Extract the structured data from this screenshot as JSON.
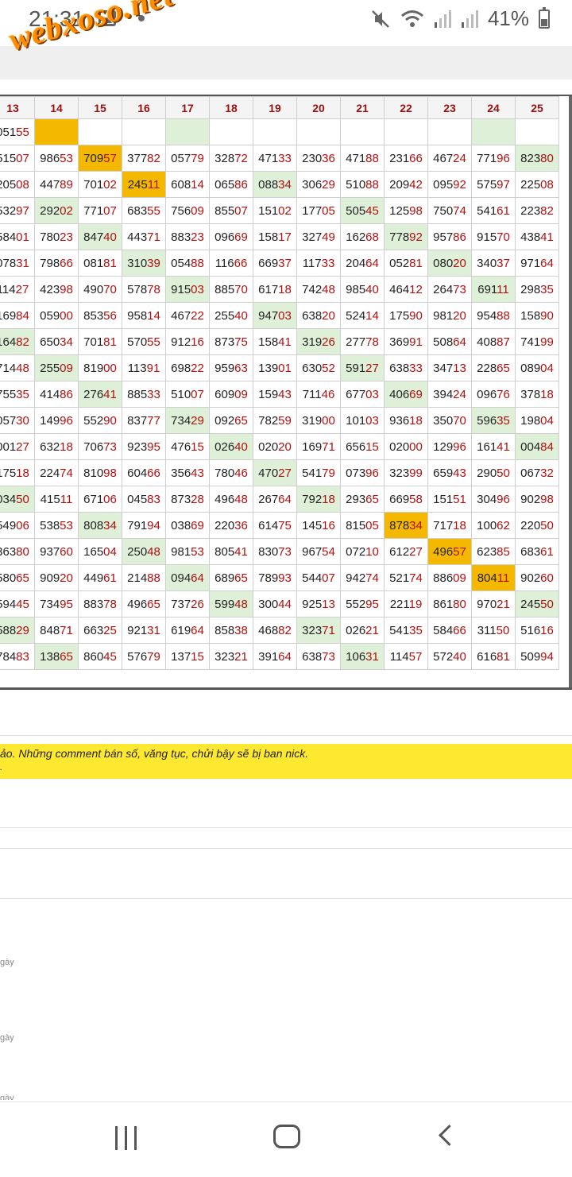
{
  "status_bar": {
    "time": "21:31",
    "battery_percent": "41%",
    "icons": [
      "image-icon",
      "app-notification-icon",
      "dot-icon",
      "mute-icon",
      "wifi-icon",
      "signal-icon",
      "signal-icon",
      "battery-icon"
    ]
  },
  "watermark": "webxoso.net",
  "table": {
    "columns": [
      "13",
      "14",
      "15",
      "16",
      "17",
      "18",
      "19",
      "20",
      "21",
      "22",
      "23",
      "24",
      "25"
    ],
    "rows": [
      [
        "05155",
        "",
        "",
        "",
        "",
        "",
        "",
        "",
        "",
        "",
        "",
        "",
        ""
      ],
      [
        "51507",
        "98653",
        "70957",
        "37782",
        "05779",
        "32872",
        "47133",
        "23036",
        "47188",
        "23166",
        "46724",
        "77196",
        "82380"
      ],
      [
        "20508",
        "44789",
        "70102",
        "24511",
        "60814",
        "06586",
        "08834",
        "30629",
        "51088",
        "20942",
        "09592",
        "57597",
        "22508"
      ],
      [
        "53297",
        "29202",
        "77107",
        "68355",
        "75609",
        "85507",
        "15102",
        "17705",
        "50545",
        "12598",
        "75074",
        "54161",
        "22382"
      ],
      [
        "58401",
        "78023",
        "84740",
        "44371",
        "88323",
        "09669",
        "15817",
        "32749",
        "16268",
        "77892",
        "95786",
        "91570",
        "43841"
      ],
      [
        "07831",
        "79866",
        "08181",
        "31039",
        "05488",
        "11666",
        "66937",
        "11733",
        "20464",
        "05281",
        "08020",
        "34037",
        "97164"
      ],
      [
        "11427",
        "42398",
        "49070",
        "57878",
        "91503",
        "88570",
        "61718",
        "74248",
        "98540",
        "46412",
        "26473",
        "69111",
        "29835"
      ],
      [
        "16984",
        "05900",
        "85356",
        "95814",
        "46722",
        "25540",
        "94703",
        "63820",
        "52414",
        "17590",
        "98120",
        "95488",
        "15890"
      ],
      [
        "16482",
        "65034",
        "70181",
        "57055",
        "91216",
        "87375",
        "15841",
        "31926",
        "27778",
        "36991",
        "50864",
        "40887",
        "74199"
      ],
      [
        "71448",
        "25509",
        "81900",
        "11391",
        "69822",
        "95963",
        "13901",
        "63052",
        "59127",
        "63833",
        "34713",
        "22865",
        "08904"
      ],
      [
        "75535",
        "41486",
        "27641",
        "88533",
        "51007",
        "60909",
        "15943",
        "71146",
        "67703",
        "40669",
        "39424",
        "09676",
        "37818"
      ],
      [
        "05730",
        "14996",
        "55290",
        "83777",
        "73429",
        "09265",
        "78259",
        "31900",
        "10103",
        "93618",
        "35070",
        "59635",
        "19804"
      ],
      [
        "00127",
        "63218",
        "70673",
        "92395",
        "47615",
        "02640",
        "02020",
        "16971",
        "65615",
        "02000",
        "12996",
        "16141",
        "00484"
      ],
      [
        "17518",
        "22474",
        "81098",
        "60466",
        "35643",
        "78046",
        "47027",
        "54179",
        "07396",
        "32399",
        "65943",
        "29050",
        "06732"
      ],
      [
        "03450",
        "41511",
        "67106",
        "04583",
        "87328",
        "49648",
        "26764",
        "79218",
        "29365",
        "66958",
        "15151",
        "30496",
        "90298"
      ],
      [
        "54906",
        "53853",
        "80834",
        "79194",
        "03869",
        "22036",
        "61475",
        "14516",
        "81505",
        "87834",
        "71718",
        "10062",
        "22050"
      ],
      [
        "36380",
        "93760",
        "16504",
        "25048",
        "98153",
        "80541",
        "83073",
        "96754",
        "07210",
        "61227",
        "49657",
        "62385",
        "68361"
      ],
      [
        "58065",
        "90920",
        "44961",
        "21488",
        "09464",
        "68965",
        "78993",
        "54407",
        "94274",
        "52174",
        "88609",
        "80411",
        "90260"
      ],
      [
        "59445",
        "73495",
        "88378",
        "49665",
        "73726",
        "59948",
        "30044",
        "92513",
        "55295",
        "22119",
        "86180",
        "97021",
        "24550"
      ],
      [
        "58829",
        "84871",
        "66325",
        "92131",
        "61964",
        "85838",
        "46882",
        "32371",
        "02621",
        "54135",
        "58466",
        "31150",
        "51616"
      ],
      [
        "78483",
        "13865",
        "86045",
        "57679",
        "13715",
        "32321",
        "39164",
        "63873",
        "10631",
        "11457",
        "57240",
        "61681",
        "50994"
      ]
    ],
    "highlights": {
      "orange": [
        [
          0,
          1
        ],
        [
          1,
          2
        ],
        [
          2,
          3
        ],
        [
          15,
          9
        ],
        [
          16,
          10
        ],
        [
          17,
          11
        ]
      ],
      "green": [
        [
          0,
          4
        ],
        [
          0,
          11
        ],
        [
          1,
          12
        ],
        [
          2,
          6
        ],
        [
          3,
          1
        ],
        [
          3,
          8
        ],
        [
          4,
          2
        ],
        [
          4,
          9
        ],
        [
          5,
          3
        ],
        [
          5,
          10
        ],
        [
          6,
          4
        ],
        [
          6,
          11
        ],
        [
          7,
          6
        ],
        [
          8,
          0
        ],
        [
          8,
          7
        ],
        [
          9,
          1
        ],
        [
          9,
          8
        ],
        [
          10,
          2
        ],
        [
          10,
          9
        ],
        [
          11,
          4
        ],
        [
          11,
          11
        ],
        [
          12,
          5
        ],
        [
          12,
          12
        ],
        [
          13,
          6
        ],
        [
          14,
          0
        ],
        [
          14,
          7
        ],
        [
          15,
          2
        ],
        [
          16,
          3
        ],
        [
          17,
          4
        ],
        [
          18,
          5
        ],
        [
          18,
          12
        ],
        [
          19,
          0
        ],
        [
          19,
          7
        ],
        [
          20,
          1
        ],
        [
          20,
          8
        ]
      ]
    },
    "colors": {
      "orange": "#f5b800",
      "green": "#dff0d8",
      "header_text": "#9a1010",
      "tail_digits": "#b01010"
    }
  },
  "notice": {
    "text": "ảo. Những comment bán số, văng tục, chửi bậy sẽ bị ban nick.",
    "sub": "."
  },
  "comments": {
    "time_labels": [
      "gày",
      "gày",
      "gày"
    ]
  },
  "nav_bar": {
    "icons": [
      "recent-apps-icon",
      "home-icon",
      "back-icon"
    ]
  }
}
